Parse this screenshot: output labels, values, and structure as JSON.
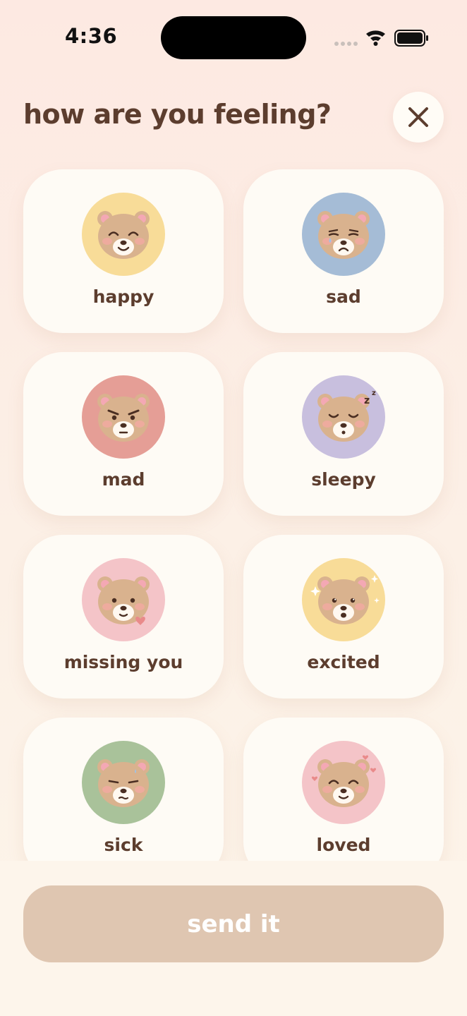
{
  "status_bar": {
    "time": "4:36"
  },
  "header": {
    "title": "how are you feeling?"
  },
  "moods": [
    {
      "id": "happy",
      "label": "happy",
      "bg_color": "#f8dc98",
      "face": "happy"
    },
    {
      "id": "sad",
      "label": "sad",
      "bg_color": "#a5bcd6",
      "face": "sad"
    },
    {
      "id": "mad",
      "label": "mad",
      "bg_color": "#e59e96",
      "face": "mad"
    },
    {
      "id": "sleepy",
      "label": "sleepy",
      "bg_color": "#c8bfde",
      "face": "sleepy"
    },
    {
      "id": "missing-you",
      "label": "missing you",
      "bg_color": "#f4c4c8",
      "face": "missing"
    },
    {
      "id": "excited",
      "label": "excited",
      "bg_color": "#f8dc98",
      "face": "excited"
    },
    {
      "id": "sick",
      "label": "sick",
      "bg_color": "#a9c29a",
      "face": "sick"
    },
    {
      "id": "loved",
      "label": "loved",
      "bg_color": "#f4c4c8",
      "face": "loved"
    }
  ],
  "footer": {
    "send_label": "send it"
  },
  "colors": {
    "text": "#5c3d2e",
    "card": "#fefbf5",
    "send_button": "#dfc6b1",
    "bear": "#d9b28e"
  }
}
